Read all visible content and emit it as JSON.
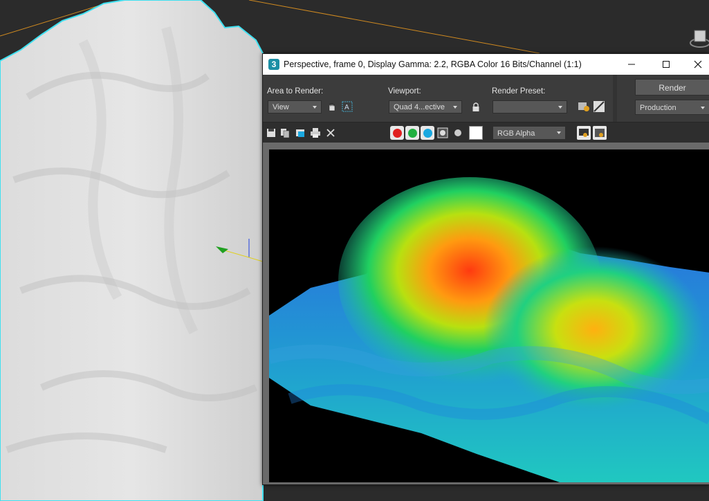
{
  "window": {
    "app_icon_label": "3",
    "title": "Perspective, frame 0, Display Gamma: 2.2, RGBA Color 16 Bits/Channel (1:1)"
  },
  "toolbar": {
    "area_label": "Area to Render:",
    "area_value": "View",
    "viewport_label": "Viewport:",
    "viewport_value": "Quad 4...ective",
    "preset_label": "Render Preset:",
    "preset_value": "",
    "render_button": "Render",
    "production_value": "Production"
  },
  "channel_bar": {
    "display_channel": "RGB Alpha"
  },
  "colors": {
    "red_channel": "#e02020",
    "green_channel": "#20b040",
    "blue_channel": "#1aa8e0",
    "selection_outline": "#3ee0f0",
    "grid_line": "#d08a20"
  }
}
